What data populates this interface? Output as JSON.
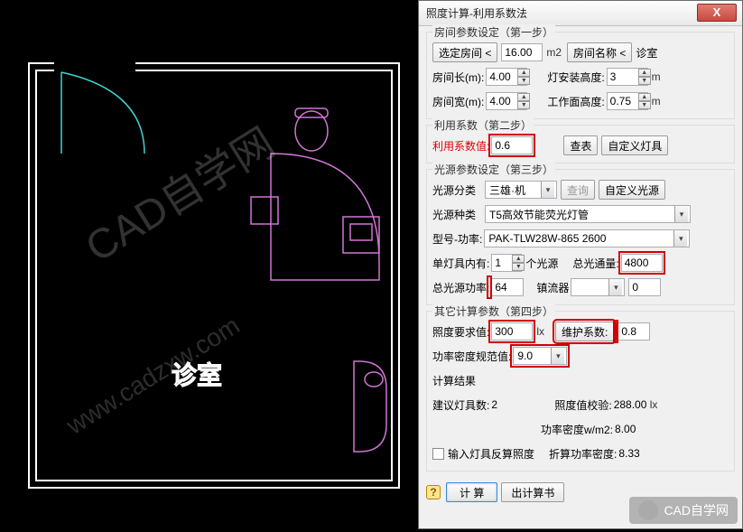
{
  "dialog_title": "照度计算-利用系数法",
  "close_x": "X",
  "cad_label": "诊室",
  "watermark_main": "CAD自学网",
  "watermark_sub": "www.cadzxw.com",
  "group1": {
    "title": "房间参数设定（第一步）",
    "select_room_btn": "选定房间 <",
    "area_value": "16.00",
    "area_unit": "m2",
    "room_name_btn": "房间名称 <",
    "room_name_value": "诊室",
    "len_label": "房间长(m):",
    "len_value": "4.00",
    "install_h_label": "灯安装高度:",
    "install_h_value": "3",
    "install_h_unit": "m",
    "width_label": "房间宽(m):",
    "width_value": "4.00",
    "work_h_label": "工作面高度:",
    "work_h_value": "0.75",
    "work_h_unit": "m"
  },
  "group2": {
    "title": "利用系数（第二步）",
    "coef_label": "利用系数值:",
    "coef_value": "0.6",
    "lookup_btn": "查表",
    "custom_fixture_btn": "自定义灯具"
  },
  "group3": {
    "title": "光源参数设定（第三步）",
    "class_label": "光源分类",
    "class_value": "三雄·机",
    "query_btn": "查询",
    "custom_src_btn": "自定义光源",
    "type_label": "光源种类",
    "type_value": "T5高效节能荧光灯管",
    "model_label": "型号-功率:",
    "model_value": "PAK-TLW28W-865          2600",
    "per_fixture_label": "单灯具内有:",
    "per_fixture_value": "1",
    "per_fixture_unit": "个光源",
    "flux_label": "总光通量:",
    "flux_value": "4800",
    "total_power_label": "总光源功率:",
    "total_power_value": "64",
    "ballast_label": "镇流器",
    "ballast_value": "0"
  },
  "group4": {
    "title": "其它计算参数（第四步）",
    "lux_req_label": "照度要求值:",
    "lux_req_value": "300",
    "lux_unit": "lx",
    "maint_label": "维护系数:",
    "maint_value": "0.8",
    "density_label": "功率密度规范值:",
    "density_value": "9.0"
  },
  "result": {
    "title": "计算结果",
    "suggest_label": "建议灯具数:",
    "suggest_value": "2",
    "check_label": "照度值校验:",
    "check_value": "288.00",
    "check_unit": "lx",
    "pd_label": "功率密度w/m2:",
    "pd_value": "8.00",
    "input_back_label": "输入灯具反算照度",
    "reduced_label": "折算功率密度:",
    "reduced_value": "8.33"
  },
  "footer": {
    "calc_btn": "计 算",
    "export_btn": "出计算书"
  },
  "overlay_text": "CAD自学网"
}
